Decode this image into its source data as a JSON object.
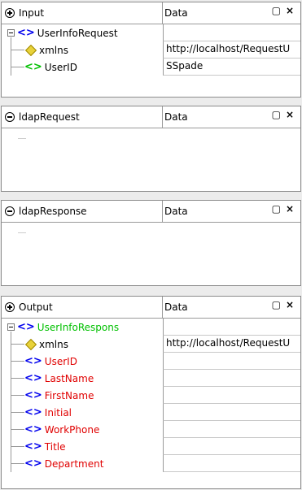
{
  "input_panel": {
    "title": "Input",
    "column": "Data",
    "root": "UserInfoRequest",
    "fields": [
      {
        "name": "xmlns",
        "value": "http://localhost/RequestU"
      },
      {
        "name": "UserID",
        "value": "SSpade"
      }
    ]
  },
  "ldap_request_panel": {
    "title": "ldapRequest",
    "column": "Data"
  },
  "ldap_response_panel": {
    "title": "ldapResponse",
    "column": "Data"
  },
  "output_panel": {
    "title": "Output",
    "column": "Data",
    "root": "UserInfoRespons",
    "xmlns": {
      "name": "xmlns",
      "value": "http://localhost/RequestU"
    },
    "fields": [
      "UserID",
      "LastName",
      "FirstName",
      "Initial",
      "WorkPhone",
      "Title",
      "Department"
    ]
  },
  "controls": {
    "maximize": "▢",
    "close": "×"
  },
  "icons": {
    "element": "<>",
    "attribute": "attribute-diamond-icon"
  }
}
